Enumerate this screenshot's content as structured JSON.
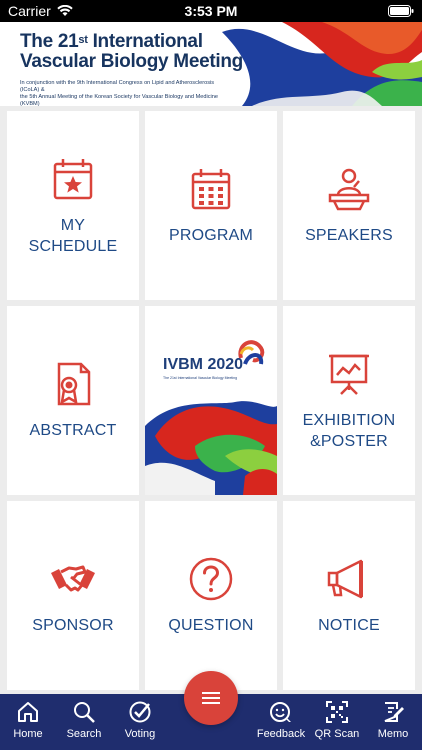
{
  "status_bar": {
    "carrier": "Carrier",
    "time": "3:53 PM"
  },
  "banner": {
    "title_line1_prefix": "The 21",
    "title_line1_sup": "st",
    "title_line1_suffix": " International",
    "title_line2": "Vascular Biology Meeting",
    "subtitle_line1": "In conjunction with the 9th International Congress on Lipid and Atherosclerosis (ICoLA) &",
    "subtitle_line2": "the 5th Annual Meeting of the Korean Society for Vascular Biology and Medicine (KVBM)"
  },
  "menu": {
    "my_schedule": {
      "line1": "MY",
      "line2": "SCHEDULE",
      "icon": "calendar-star-icon"
    },
    "program": {
      "label": "PROGRAM",
      "icon": "calendar-grid-icon"
    },
    "speakers": {
      "label": "SPEAKERS",
      "icon": "speaker-podium-icon"
    },
    "abstract": {
      "label": "ABSTRACT",
      "icon": "certificate-document-icon"
    },
    "exhibition": {
      "line1": "EXHIBITION",
      "line2": "&POSTER",
      "icon": "presentation-board-icon"
    },
    "sponsor": {
      "label": "SPONSOR",
      "icon": "handshake-icon"
    },
    "question": {
      "label": "QUESTION",
      "icon": "question-circle-icon"
    },
    "notice": {
      "label": "NOTICE",
      "icon": "megaphone-icon"
    }
  },
  "event_logo": {
    "name": "IVBM 2020",
    "subtitle": "The 21st International Vascular Biology Meeting"
  },
  "bottom_nav": {
    "home": "Home",
    "search": "Search",
    "voting": "Voting",
    "feedback": "Feedback",
    "qr_scan": "QR Scan",
    "memo": "Memo"
  },
  "colors": {
    "accent_red": "#d9433a",
    "label_blue": "#1f4a86",
    "nav_navy": "#1f2d6e"
  }
}
